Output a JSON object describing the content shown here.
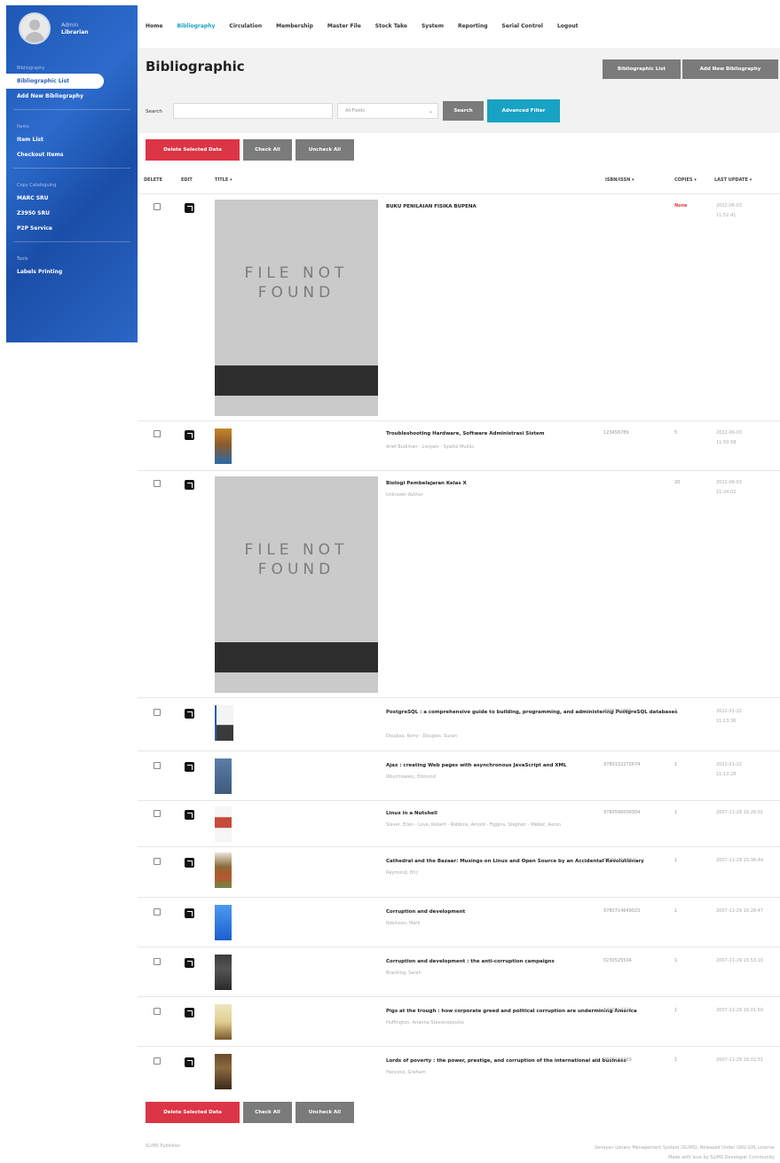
{
  "sidebar": {
    "user_name": "Admin",
    "user_role": "Librarian",
    "sections": [
      {
        "label": "Bibliography",
        "items": [
          {
            "label": "Bibliographic List",
            "active": true
          },
          {
            "label": "Add New Bibliography",
            "active": false
          }
        ]
      },
      {
        "label": "Items",
        "items": [
          {
            "label": "Item List",
            "active": false
          },
          {
            "label": "Checkout Items",
            "active": false
          }
        ]
      },
      {
        "label": "Copy Cataloguing",
        "items": [
          {
            "label": "MARC SRU",
            "active": false
          },
          {
            "label": "Z3950 SRU",
            "active": false
          },
          {
            "label": "P2P Service",
            "active": false
          }
        ]
      },
      {
        "label": "Tools",
        "items": [
          {
            "label": "Labels Printing",
            "active": false
          }
        ]
      }
    ]
  },
  "topnav": [
    {
      "label": "Home",
      "active": false
    },
    {
      "label": "Bibliography",
      "active": true
    },
    {
      "label": "Circulation",
      "active": false
    },
    {
      "label": "Membership",
      "active": false
    },
    {
      "label": "Master File",
      "active": false
    },
    {
      "label": "Stock Take",
      "active": false
    },
    {
      "label": "System",
      "active": false
    },
    {
      "label": "Reporting",
      "active": false
    },
    {
      "label": "Serial Control",
      "active": false
    },
    {
      "label": "Logout",
      "active": false
    }
  ],
  "header": {
    "title": "Bibliographic",
    "btn_list": "Bibliographic List",
    "btn_add": "Add New Bibliography"
  },
  "search": {
    "label": "Search",
    "value": "",
    "field_select": "All Fields",
    "search_btn": "Search",
    "advanced_btn": "Advanced Filter"
  },
  "actions": {
    "delete": "Delete Selected Data",
    "check_all": "Check All",
    "uncheck_all": "Uncheck All"
  },
  "columns": {
    "delete": "DELETE",
    "edit": "EDIT",
    "title": "TITLE ▾",
    "isbn": "ISBN/ISSN ▾",
    "copies": "COPIES ▾",
    "last_update": "LAST UPDATE ▾"
  },
  "cover_placeholder": {
    "line1": "FILE NOT",
    "line2": "FOUND"
  },
  "rows": [
    {
      "title": "BUKU PENILAIAN FISIKA BUPENA",
      "author": "",
      "isbn": "",
      "copies": "None",
      "update": [
        "2022-06-03",
        "11:52:41"
      ],
      "cover": "missing"
    },
    {
      "title": "Troubleshooting Hardware, Software Administrasi Sistem",
      "author": "Arief Budiman - Liviyani - Syaiful Muklis",
      "isbn": "123456789",
      "copies": "5",
      "update": [
        "2022-06-03",
        "11:50:58"
      ],
      "cover": "#b4742c"
    },
    {
      "title": "Biologi Pembelajaran Kelas X",
      "author": "Unknown Author",
      "isbn": "",
      "copies": "20",
      "update": [
        "2022-06-03",
        "11:24:02"
      ],
      "cover": "missing"
    },
    {
      "title": "PostgreSQL : a comprehensive guide to building, programming, and administering PostgreSQL databases",
      "author": "Douglas, Korry - Douglas, Susan",
      "isbn": "0735712573",
      "copies": "1",
      "update": [
        "2022-01-22",
        "11:13:36"
      ],
      "cover": "#3b3b3b"
    },
    {
      "title": "Ajax : creating Web pages with asynchronous JavaScript and XML",
      "author": "Woychowsky, Edmond",
      "isbn": "9780132272674",
      "copies": "1",
      "update": [
        "2022-01-22",
        "11:13:28"
      ],
      "cover": "#4a6a8e"
    },
    {
      "title": "Linux in a Nutshell",
      "author": "Siever, Ellen - Love, Robert - Robbins, Arnold - Figgins, Stephen - Weber, Aaron",
      "isbn": "9780596009304",
      "copies": "1",
      "update": [
        "2007-11-29 16:26:01"
      ],
      "cover": "#c94a3a"
    },
    {
      "title": "Cathedral and the Bazaar: Musings on Linux and Open Source by an Accidental Revolutionary",
      "author": "Raymond, Eric",
      "isbn": "0-596-10608-X",
      "copies": "1",
      "update": [
        "2007-11-29 15:36:44"
      ],
      "cover": "#8a5a2e"
    },
    {
      "title": "Corruption and development",
      "author": "Robinson, Mark",
      "isbn": "9780714649023",
      "copies": "1",
      "update": [
        "2007-11-29 16:28:47"
      ],
      "cover": "#2878d8"
    },
    {
      "title": "Corruption and development : the anti-corruption campaigns",
      "author": "Bracking, Sarah",
      "isbn": "0230525504",
      "copies": "1",
      "update": [
        "2007-11-29 15:53:16"
      ],
      "cover": "#2e2e2e"
    },
    {
      "title": "Pigs at the trough : how corporate greed and political corruption are undermining America",
      "author": "Huffington, Arianna Stassinopoulos",
      "isbn": "1400047714",
      "copies": "1",
      "update": [
        "2007-11-29 16:01:59"
      ],
      "cover": "#e8d8a0"
    },
    {
      "title": "Lords of poverty : the power, prestige, and corruption of the international aid business",
      "author": "Hancock, Graham",
      "isbn": "0871133469",
      "copies": "1",
      "update": [
        "2007-11-29 16:02:51"
      ],
      "cover": "#5a3a22"
    }
  ],
  "footer": {
    "left": "SLiMS Publisher",
    "right_line1": "Senayan Library Management System (SLiMS). Released Under GNU GPL License",
    "right_line2": "Made with love by SLiMS Developer Community"
  }
}
